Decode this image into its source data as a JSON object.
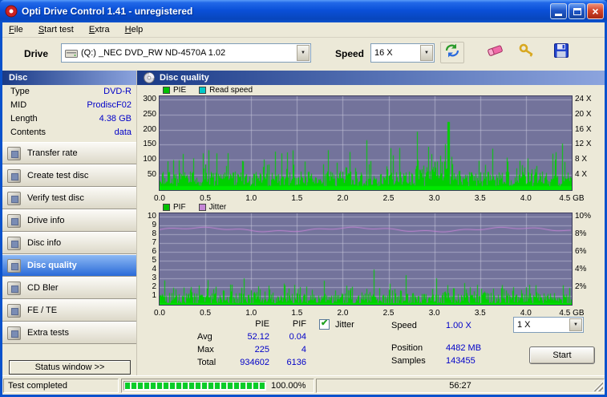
{
  "window": {
    "title": "Opti Drive Control 1.41 - unregistered"
  },
  "menu": {
    "items": [
      "File",
      "Start test",
      "Extra",
      "Help"
    ]
  },
  "toolbar": {
    "drive_label": "Drive",
    "drive_value": "(Q:)  _NEC DVD_RW ND-4570A 1.02",
    "speed_label": "Speed",
    "speed_value": "16 X"
  },
  "sidebar": {
    "header": "Disc",
    "info": [
      {
        "label": "Type",
        "value": "DVD-R"
      },
      {
        "label": "MID",
        "value": "ProdiscF02"
      },
      {
        "label": "Length",
        "value": "4.38 GB"
      },
      {
        "label": "Contents",
        "value": "data"
      }
    ],
    "buttons": [
      "Transfer rate",
      "Create test disc",
      "Verify test disc",
      "Drive info",
      "Disc info",
      "Disc quality",
      "CD Bler",
      "FE / TE",
      "Extra tests"
    ],
    "status_window": "Status window >>"
  },
  "main": {
    "header": "Disc quality",
    "results": {
      "col_pie": "PIE",
      "col_pif": "PIF",
      "avg_label": "Avg",
      "avg_pie": "52.12",
      "avg_pif": "0.04",
      "max_label": "Max",
      "max_pie": "225",
      "max_pif": "4",
      "total_label": "Total",
      "total_pie": "934602",
      "total_pif": "6136",
      "jitter_label": "Jitter",
      "jitter_checked": true,
      "speed_label": "Speed",
      "speed_value": "1.00 X",
      "position_label": "Position",
      "position_value": "4482 MB",
      "samples_label": "Samples",
      "samples_value": "143455",
      "speed_select": "1 X",
      "start_button": "Start"
    }
  },
  "statusbar": {
    "status": "Test completed",
    "progress": "100.00%",
    "time": "56:27"
  },
  "chart_data": [
    {
      "id": "pie-chart",
      "type": "area",
      "title": "PIE / Read speed",
      "legend": [
        {
          "label": "PIE",
          "color": "#00c000"
        },
        {
          "label": "Read speed",
          "color": "#00c8c8"
        }
      ],
      "ymax": 310,
      "left_ticks": [
        300,
        250,
        200,
        150,
        100,
        50
      ],
      "right_ticks": [
        "24 X",
        "20 X",
        "16 X",
        "12 X",
        "8 X",
        "4 X"
      ],
      "right_vals": [
        300,
        250,
        200,
        150,
        100,
        50
      ],
      "x_ticks": [
        "0.0",
        "0.5",
        "1.0",
        "1.5",
        "2.0",
        "2.5",
        "3.0",
        "3.5",
        "4.0",
        "4.5 GB"
      ],
      "x_range_gb": [
        0,
        4.5
      ],
      "stats": {
        "avg": 52.12,
        "max": 225,
        "total": 934602
      },
      "bg": "#73739b",
      "grid_color": "rgba(198,198,220,0.6)",
      "vgrid": 9,
      "gen": {
        "seed": 20,
        "base": [
          12,
          62
        ],
        "mid": [
          68,
          140
        ],
        "mid_p": 0.13,
        "high": [
          140,
          168
        ],
        "high_p": 0.012,
        "cluster": [
          0.62,
          0.73,
          45
        ],
        "peak": [
          0.7,
          225,
          0.0025
        ],
        "strip": 5,
        "color": "#00cf00",
        "strip_color": "#00e800"
      },
      "overlay": {
        "color": "#00c8c8",
        "value": 12,
        "noise": 0,
        "under": true
      }
    },
    {
      "id": "pif-chart",
      "type": "area",
      "title": "PIF / Jitter",
      "legend": [
        {
          "label": "PIF",
          "color": "#00c000"
        },
        {
          "label": "Jitter",
          "color": "#c586d6"
        }
      ],
      "ymax": 10.4,
      "left_ticks": [
        10,
        9,
        8,
        7,
        6,
        5,
        4,
        3,
        2,
        1
      ],
      "right_ticks": [
        "10%",
        "8%",
        "6%",
        "4%",
        "2%"
      ],
      "right_vals": [
        10,
        8,
        6,
        4,
        2
      ],
      "x_ticks": [
        "0.0",
        "0.5",
        "1.0",
        "1.5",
        "2.0",
        "2.5",
        "3.0",
        "3.5",
        "4.0",
        "4.5 GB"
      ],
      "x_range_gb": [
        0,
        4.5
      ],
      "stats": {
        "avg": 0.04,
        "max": 4,
        "total": 6136
      },
      "bg": "#73739b",
      "grid_color": "rgba(198,198,220,0.6)",
      "vgrid": 9,
      "gen": {
        "seed": 5,
        "base": [
          0,
          1.35
        ],
        "mid": [
          1.0,
          2.3
        ],
        "mid_p": 0.22,
        "high": [
          2.4,
          3.6
        ],
        "high_p": 0.02,
        "cluster": null,
        "peak": [
          0.52,
          4,
          0.001
        ],
        "strip": 2,
        "color": "#00cf00",
        "strip_color": "#00e400"
      },
      "overlay": {
        "color": "#c586d6",
        "value": 8.55,
        "noise": 0.2,
        "under": false
      }
    }
  ]
}
